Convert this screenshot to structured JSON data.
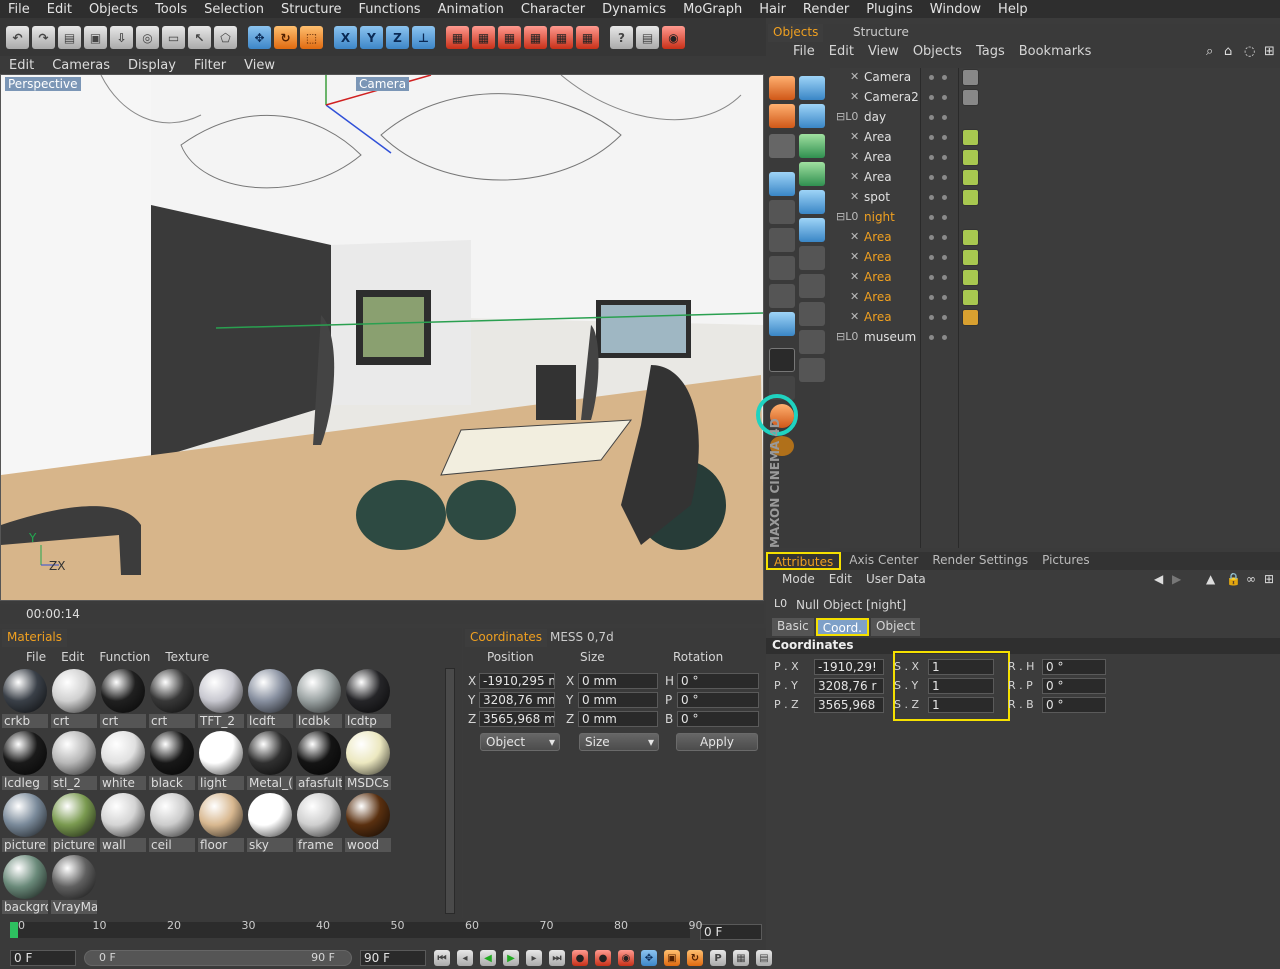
{
  "menubar": [
    "File",
    "Edit",
    "Objects",
    "Tools",
    "Selection",
    "Structure",
    "Functions",
    "Animation",
    "Character",
    "Dynamics",
    "MoGraph",
    "Hair",
    "Render",
    "Plugins",
    "Window",
    "Help"
  ],
  "toolbar_axis": [
    "X",
    "Y",
    "Z"
  ],
  "viewport_menu": [
    "Edit",
    "Cameras",
    "Display",
    "Filter",
    "View"
  ],
  "viewport": {
    "label": "Perspective",
    "camera_label": "Camera",
    "axis_y": "Y",
    "axis_zx": "ZX"
  },
  "status_time": "00:00:14",
  "materials_panel": {
    "tab": "Materials",
    "menu": [
      "File",
      "Edit",
      "Function",
      "Texture"
    ],
    "items": [
      {
        "name": "crkb",
        "color": "#3a4048"
      },
      {
        "name": "crt",
        "color": "#d0d0d0"
      },
      {
        "name": "crt",
        "color": "#202020"
      },
      {
        "name": "crt",
        "color": "#383838"
      },
      {
        "name": "TFT_2",
        "color": "#c8c8d0"
      },
      {
        "name": "lcdft",
        "color": "#8890a0"
      },
      {
        "name": "lcdbk",
        "color": "#9aa2a2"
      },
      {
        "name": "lcdtp",
        "color": "#252528"
      },
      {
        "name": "lcdleg",
        "color": "#1a1a1a"
      },
      {
        "name": "stl_2",
        "color": "#b8b8b8"
      },
      {
        "name": "white",
        "color": "#e0e0e0"
      },
      {
        "name": "black",
        "color": "#181818"
      },
      {
        "name": "light",
        "color": "#ffffff"
      },
      {
        "name": "Metal_(",
        "color": "#303030"
      },
      {
        "name": "afasfult",
        "color": "#141414"
      },
      {
        "name": "MSDCs",
        "color": "#ece8c0"
      },
      {
        "name": "picture",
        "color": "#7a8a9a"
      },
      {
        "name": "picture",
        "color": "#7a9a50"
      },
      {
        "name": "wall",
        "color": "#d4d4d4"
      },
      {
        "name": "ceil",
        "color": "#cccccc"
      },
      {
        "name": "floor",
        "color": "#d8b890"
      },
      {
        "name": "sky",
        "color": "#ffffff"
      },
      {
        "name": "frame",
        "color": "#cfcfcf"
      },
      {
        "name": "wood",
        "color": "#5a3010"
      },
      {
        "name": "backgro",
        "color": "#6a8a7a"
      },
      {
        "name": "VrayMa",
        "color": "#606060"
      }
    ]
  },
  "coords_panel": {
    "tabs": [
      "Coordinates",
      "MESS 0,7d"
    ],
    "headers": [
      "Position",
      "Size",
      "Rotation"
    ],
    "rows": [
      {
        "axis": "X",
        "pos": "-1910,295 m",
        "size_axis": "X",
        "size": "0 mm",
        "rot_axis": "H",
        "rot": "0 °"
      },
      {
        "axis": "Y",
        "pos": "3208,76 mm",
        "size_axis": "Y",
        "size": "0 mm",
        "rot_axis": "P",
        "rot": "0 °"
      },
      {
        "axis": "Z",
        "pos": "3565,968 mn",
        "size_axis": "Z",
        "size": "0 mm",
        "rot_axis": "B",
        "rot": "0 °"
      }
    ],
    "mode_select": "Object",
    "size_select": "Size",
    "apply": "Apply"
  },
  "objects_panel": {
    "tabs": [
      "Objects",
      "Structure"
    ],
    "menu": [
      "File",
      "Edit",
      "View",
      "Objects",
      "Tags",
      "Bookmarks"
    ],
    "items": [
      {
        "name": "Camera",
        "indent": 1,
        "active": false
      },
      {
        "name": "Camera2",
        "indent": 1,
        "active": false
      },
      {
        "name": "day",
        "indent": 0,
        "active": false
      },
      {
        "name": "Area",
        "indent": 1,
        "active": false
      },
      {
        "name": "Area",
        "indent": 1,
        "active": false
      },
      {
        "name": "Area",
        "indent": 1,
        "active": false
      },
      {
        "name": "spot",
        "indent": 1,
        "active": false
      },
      {
        "name": "night",
        "indent": 0,
        "active": true
      },
      {
        "name": "Area",
        "indent": 1,
        "active": true
      },
      {
        "name": "Area",
        "indent": 1,
        "active": true
      },
      {
        "name": "Area",
        "indent": 1,
        "active": true
      },
      {
        "name": "Area",
        "indent": 1,
        "active": true
      },
      {
        "name": "Area",
        "indent": 1,
        "active": true
      },
      {
        "name": "museum",
        "indent": 0,
        "active": false
      }
    ]
  },
  "brand": "MAXON CINEMA 4D",
  "attributes": {
    "tabs": [
      "Attributes",
      "Axis Center",
      "Render Settings",
      "Pictures"
    ],
    "menu": [
      "Mode",
      "Edit",
      "User Data"
    ],
    "object_title": "Null Object [night]",
    "subtabs": [
      "Basic",
      "Coord.",
      "Object"
    ],
    "section": "Coordinates",
    "rows": [
      {
        "p": "P . X",
        "pv": "-1910,29!",
        "s": "S . X",
        "sv": "1",
        "r": "R . H",
        "rv": "0 °"
      },
      {
        "p": "P . Y",
        "pv": "3208,76 r",
        "s": "S . Y",
        "sv": "1",
        "r": "R . P",
        "rv": "0 °"
      },
      {
        "p": "P . Z",
        "pv": "3565,968",
        "s": "S . Z",
        "sv": "1",
        "r": "R . B",
        "rv": "0 °"
      }
    ]
  },
  "timeline": {
    "ticks": [
      "0",
      "10",
      "20",
      "30",
      "40",
      "50",
      "60",
      "70",
      "80",
      "90"
    ],
    "frame_field": "0 F",
    "start": "0 F",
    "range_start": "0 F",
    "range_end": "90 F",
    "end": "90 F"
  }
}
